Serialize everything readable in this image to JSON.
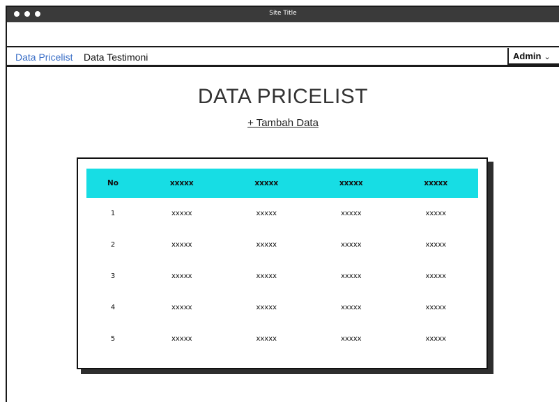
{
  "window": {
    "site_title": "Site Title"
  },
  "nav": {
    "items": [
      {
        "label": "Data Pricelist",
        "active": true
      },
      {
        "label": "Data Testimoni",
        "active": false
      }
    ],
    "user_menu": {
      "label": "Admin",
      "icon": "chevron-down-icon"
    }
  },
  "page": {
    "heading": "DATA PRICELIST",
    "add_label": "+ Tambah Data"
  },
  "table": {
    "headers": [
      "No",
      "xxxxx",
      "xxxxx",
      "xxxxx",
      "xxxxx"
    ],
    "rows": [
      [
        "1",
        "xxxxx",
        "xxxxx",
        "xxxxx",
        "xxxxx"
      ],
      [
        "2",
        "xxxxx",
        "xxxxx",
        "xxxxx",
        "xxxxx"
      ],
      [
        "3",
        "xxxxx",
        "xxxxx",
        "xxxxx",
        "xxxxx"
      ],
      [
        "4",
        "xxxxx",
        "xxxxx",
        "xxxxx",
        "xxxxx"
      ],
      [
        "5",
        "xxxxx",
        "xxxxx",
        "xxxxx",
        "xxxxx"
      ]
    ]
  },
  "colors": {
    "titlebar": "#3a3a3a",
    "active_link": "#3b6fc7",
    "table_header": "#17dde4"
  }
}
